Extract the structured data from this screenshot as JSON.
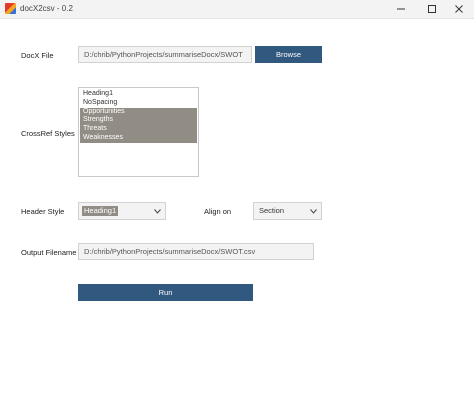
{
  "window": {
    "title": "docX2csv - 0.2"
  },
  "docx_file": {
    "label": "DocX File",
    "value": "D:/chrib/PythonProjects/summariseDocx/SWOT",
    "browse_label": "Browse"
  },
  "crossref": {
    "label": "CrossRef Styles",
    "items": [
      {
        "text": "Heading1",
        "selected": false
      },
      {
        "text": "NoSpacing",
        "selected": false
      },
      {
        "text": "Opportunities",
        "selected": true
      },
      {
        "text": "Strengths",
        "selected": true
      },
      {
        "text": "Threats",
        "selected": true
      },
      {
        "text": "Weaknesses",
        "selected": true
      }
    ]
  },
  "header_style": {
    "label": "Header Style",
    "value": "Heading1"
  },
  "align_on": {
    "label": "Align on",
    "value": "Section"
  },
  "output": {
    "label": "Output Filename",
    "value": "D:/chrib/PythonProjects/summariseDocx/SWOT.csv"
  },
  "run_label": "Run",
  "colors": {
    "accent": "#31587f",
    "selection": "#918c84"
  }
}
